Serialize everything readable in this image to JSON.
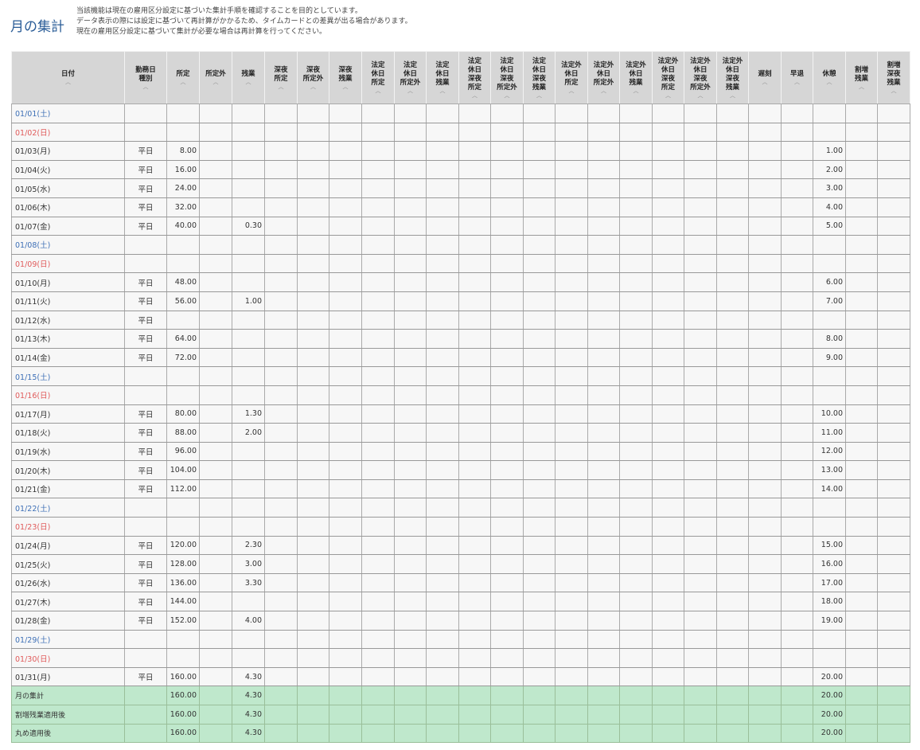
{
  "page": {
    "title": "月の集計",
    "notice": [
      "当該機能は現在の雇用区分設定に基づいた集計手順を確認することを目的としています。",
      "データ表示の際には設定に基づいて再計算がかかるため、タイムカードとの差異が出る場合があります。",
      "現在の雇用区分設定に基づいて集計が必要な場合は再計算を行ってください。"
    ],
    "sort_indicator": "︿"
  },
  "columns": [
    [
      "日付"
    ],
    [
      "勤務日",
      "種別"
    ],
    [
      "所定"
    ],
    [
      "所定外"
    ],
    [
      "残業"
    ],
    [
      "深夜",
      "所定"
    ],
    [
      "深夜",
      "所定外"
    ],
    [
      "深夜",
      "残業"
    ],
    [
      "法定",
      "休日",
      "所定"
    ],
    [
      "法定",
      "休日",
      "所定外"
    ],
    [
      "法定",
      "休日",
      "残業"
    ],
    [
      "法定",
      "休日",
      "深夜",
      "所定"
    ],
    [
      "法定",
      "休日",
      "深夜",
      "所定外"
    ],
    [
      "法定",
      "休日",
      "深夜",
      "残業"
    ],
    [
      "法定外",
      "休日",
      "所定"
    ],
    [
      "法定外",
      "休日",
      "所定外"
    ],
    [
      "法定外",
      "休日",
      "残業"
    ],
    [
      "法定外",
      "休日",
      "深夜",
      "所定"
    ],
    [
      "法定外",
      "休日",
      "深夜",
      "所定外"
    ],
    [
      "法定外",
      "休日",
      "深夜",
      "残業"
    ],
    [
      "遅刻"
    ],
    [
      "早退"
    ],
    [
      "休憩"
    ],
    [
      "割増",
      "残業"
    ],
    [
      "割増",
      "深夜",
      "残業"
    ]
  ],
  "rows": [
    {
      "date": "01/01(土)",
      "type": "sat",
      "kind": "",
      "shotei": "",
      "zangyo": "",
      "kyukei": ""
    },
    {
      "date": "01/02(日)",
      "type": "sun",
      "kind": "",
      "shotei": "",
      "zangyo": "",
      "kyukei": ""
    },
    {
      "date": "01/03(月)",
      "type": "",
      "kind": "平日",
      "shotei": "8.00",
      "zangyo": "",
      "kyukei": "1.00"
    },
    {
      "date": "01/04(火)",
      "type": "",
      "kind": "平日",
      "shotei": "16.00",
      "zangyo": "",
      "kyukei": "2.00"
    },
    {
      "date": "01/05(水)",
      "type": "",
      "kind": "平日",
      "shotei": "24.00",
      "zangyo": "",
      "kyukei": "3.00"
    },
    {
      "date": "01/06(木)",
      "type": "",
      "kind": "平日",
      "shotei": "32.00",
      "zangyo": "",
      "kyukei": "4.00"
    },
    {
      "date": "01/07(金)",
      "type": "",
      "kind": "平日",
      "shotei": "40.00",
      "zangyo": "0.30",
      "kyukei": "5.00"
    },
    {
      "date": "01/08(土)",
      "type": "sat",
      "kind": "",
      "shotei": "",
      "zangyo": "",
      "kyukei": ""
    },
    {
      "date": "01/09(日)",
      "type": "sun",
      "kind": "",
      "shotei": "",
      "zangyo": "",
      "kyukei": ""
    },
    {
      "date": "01/10(月)",
      "type": "",
      "kind": "平日",
      "shotei": "48.00",
      "zangyo": "",
      "kyukei": "6.00"
    },
    {
      "date": "01/11(火)",
      "type": "",
      "kind": "平日",
      "shotei": "56.00",
      "zangyo": "1.00",
      "kyukei": "7.00"
    },
    {
      "date": "01/12(水)",
      "type": "",
      "kind": "平日",
      "shotei": "",
      "zangyo": "",
      "kyukei": ""
    },
    {
      "date": "01/13(木)",
      "type": "",
      "kind": "平日",
      "shotei": "64.00",
      "zangyo": "",
      "kyukei": "8.00"
    },
    {
      "date": "01/14(金)",
      "type": "",
      "kind": "平日",
      "shotei": "72.00",
      "zangyo": "",
      "kyukei": "9.00"
    },
    {
      "date": "01/15(土)",
      "type": "sat",
      "kind": "",
      "shotei": "",
      "zangyo": "",
      "kyukei": ""
    },
    {
      "date": "01/16(日)",
      "type": "sun",
      "kind": "",
      "shotei": "",
      "zangyo": "",
      "kyukei": ""
    },
    {
      "date": "01/17(月)",
      "type": "",
      "kind": "平日",
      "shotei": "80.00",
      "zangyo": "1.30",
      "kyukei": "10.00"
    },
    {
      "date": "01/18(火)",
      "type": "",
      "kind": "平日",
      "shotei": "88.00",
      "zangyo": "2.00",
      "kyukei": "11.00"
    },
    {
      "date": "01/19(水)",
      "type": "",
      "kind": "平日",
      "shotei": "96.00",
      "zangyo": "",
      "kyukei": "12.00"
    },
    {
      "date": "01/20(木)",
      "type": "",
      "kind": "平日",
      "shotei": "104.00",
      "zangyo": "",
      "kyukei": "13.00"
    },
    {
      "date": "01/21(金)",
      "type": "",
      "kind": "平日",
      "shotei": "112.00",
      "zangyo": "",
      "kyukei": "14.00"
    },
    {
      "date": "01/22(土)",
      "type": "sat",
      "kind": "",
      "shotei": "",
      "zangyo": "",
      "kyukei": ""
    },
    {
      "date": "01/23(日)",
      "type": "sun",
      "kind": "",
      "shotei": "",
      "zangyo": "",
      "kyukei": ""
    },
    {
      "date": "01/24(月)",
      "type": "",
      "kind": "平日",
      "shotei": "120.00",
      "zangyo": "2.30",
      "kyukei": "15.00"
    },
    {
      "date": "01/25(火)",
      "type": "",
      "kind": "平日",
      "shotei": "128.00",
      "zangyo": "3.00",
      "kyukei": "16.00"
    },
    {
      "date": "01/26(水)",
      "type": "",
      "kind": "平日",
      "shotei": "136.00",
      "zangyo": "3.30",
      "kyukei": "17.00"
    },
    {
      "date": "01/27(木)",
      "type": "",
      "kind": "平日",
      "shotei": "144.00",
      "zangyo": "",
      "kyukei": "18.00"
    },
    {
      "date": "01/28(金)",
      "type": "",
      "kind": "平日",
      "shotei": "152.00",
      "zangyo": "4.00",
      "kyukei": "19.00"
    },
    {
      "date": "01/29(土)",
      "type": "sat",
      "kind": "",
      "shotei": "",
      "zangyo": "",
      "kyukei": ""
    },
    {
      "date": "01/30(日)",
      "type": "sun",
      "kind": "",
      "shotei": "",
      "zangyo": "",
      "kyukei": ""
    },
    {
      "date": "01/31(月)",
      "type": "",
      "kind": "平日",
      "shotei": "160.00",
      "zangyo": "4.30",
      "kyukei": "20.00"
    }
  ],
  "summary_rows": [
    {
      "label": "月の集計",
      "shotei": "160.00",
      "zangyo": "4.30",
      "kyukei": "20.00"
    },
    {
      "label": "割増残業適用後",
      "shotei": "160.00",
      "zangyo": "4.30",
      "kyukei": "20.00"
    },
    {
      "label": "丸め適用後",
      "shotei": "160.00",
      "zangyo": "4.30",
      "kyukei": "20.00"
    }
  ],
  "colors": {
    "title": "#2a5c97",
    "header_bg": "#d6d6d6",
    "row_bg": "#f7f7f7",
    "saturday": "#3d6fb6",
    "sunday": "#e05a5a",
    "summary_bg": "#bfe8cc"
  }
}
